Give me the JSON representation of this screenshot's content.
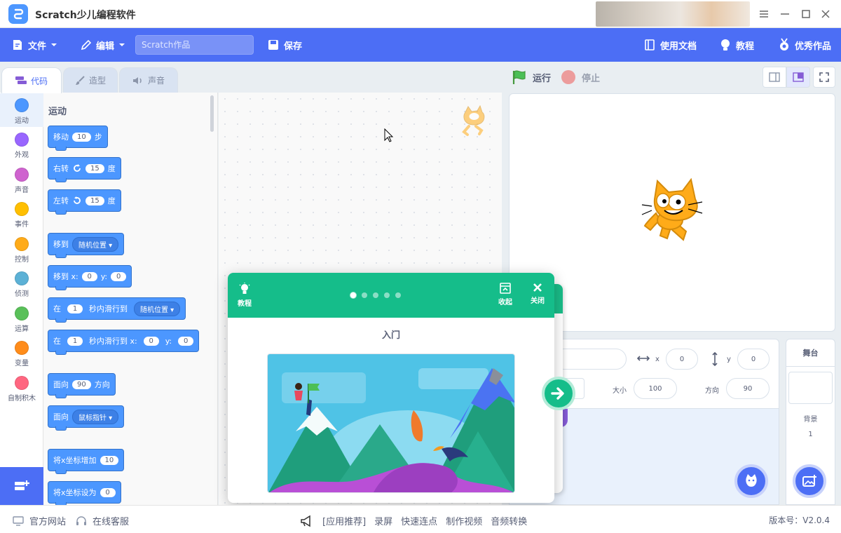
{
  "app": {
    "title": "Scratch少儿编程软件"
  },
  "menubar": {
    "file": "文件",
    "edit": "编辑",
    "project_placeholder": "Scratch作品",
    "save": "保存",
    "docs": "使用文档",
    "tutorials": "教程",
    "featured": "优秀作品"
  },
  "tabs": [
    {
      "label": "代码",
      "icon": "code-icon"
    },
    {
      "label": "造型",
      "icon": "brush-icon"
    },
    {
      "label": "声音",
      "icon": "speaker-icon"
    }
  ],
  "categories": [
    {
      "label": "运动",
      "color": "#4c97ff"
    },
    {
      "label": "外观",
      "color": "#9966ff"
    },
    {
      "label": "声音",
      "color": "#cf63cf"
    },
    {
      "label": "事件",
      "color": "#ffbf00"
    },
    {
      "label": "控制",
      "color": "#ffab19"
    },
    {
      "label": "侦测",
      "color": "#5cb1d6"
    },
    {
      "label": "运算",
      "color": "#59c059"
    },
    {
      "label": "变量",
      "color": "#ff8c1a"
    },
    {
      "label": "自制积木",
      "color": "#ff6680"
    }
  ],
  "palette": {
    "heading": "运动",
    "blocks": {
      "move": {
        "a": "移动",
        "v": "10",
        "b": "步"
      },
      "turn_right": {
        "a": "右转",
        "v": "15",
        "b": "度"
      },
      "turn_left": {
        "a": "左转",
        "v": "15",
        "b": "度"
      },
      "goto": {
        "a": "移到",
        "dd": "随机位置"
      },
      "goto_xy": {
        "a": "移到 x:",
        "x": "0",
        "ylab": "y:",
        "y": "0"
      },
      "glide": {
        "a": "在",
        "v": "1",
        "b": "秒内滑行到",
        "dd": "随机位置"
      },
      "glide_xy": {
        "a": "在",
        "v": "1",
        "b": "秒内滑行到 x:",
        "x": "0",
        "ylab": "y:",
        "y": "0"
      },
      "point_dir": {
        "a": "面向",
        "v": "90",
        "b": "方向"
      },
      "point_towards": {
        "a": "面向",
        "dd": "鼠标指针"
      },
      "change_x": {
        "a": "将x坐标增加",
        "v": "10"
      },
      "set_x": {
        "a": "将x坐标设为",
        "v": "0"
      }
    }
  },
  "stage_controls": {
    "run": "运行",
    "stop": "停止"
  },
  "sprite_info": {
    "x_label": "x",
    "x_value": "0",
    "y_label": "y",
    "y_value": "0",
    "size_label": "大小",
    "size_value": "100",
    "direction_label": "方向",
    "direction_value": "90"
  },
  "stage_panel": {
    "title": "舞台",
    "backdrop_label": "背景",
    "backdrop_count": "1"
  },
  "tutorial": {
    "tutorial_label": "教程",
    "collapse_label": "收起",
    "close_label": "关闭",
    "heading": "入门",
    "page_count": 5,
    "active_page": 1
  },
  "statusbar": {
    "website": "官方网站",
    "support": "在线客服",
    "recommend": "[应用推荐]",
    "apps": [
      "录屏",
      "快速连点",
      "制作视频",
      "音频转换"
    ],
    "version": "版本号：V2.0.4"
  },
  "colors": {
    "brand": "#4c6ef5",
    "motion": "#4c97ff",
    "tutorial": "#15bd8a"
  }
}
